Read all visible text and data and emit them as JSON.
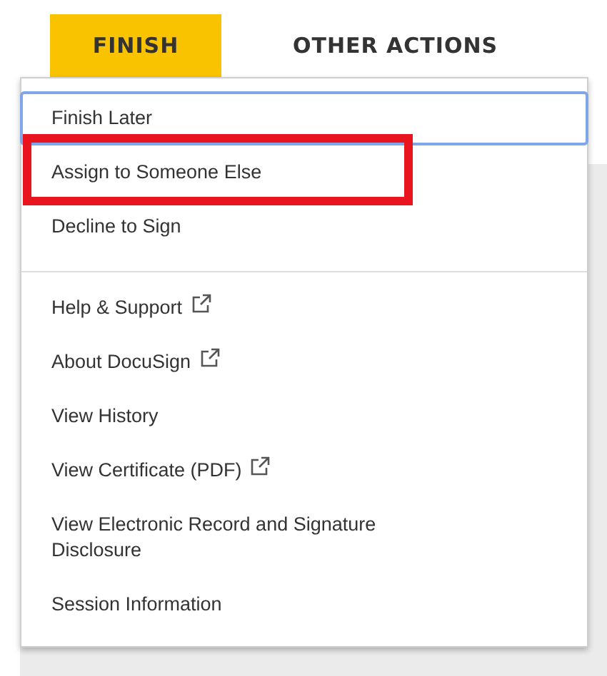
{
  "tabs": [
    {
      "label": "FINISH",
      "selected": true
    },
    {
      "label": "OTHER ACTIONS",
      "selected": false
    }
  ],
  "menu": {
    "groups": [
      {
        "items": [
          {
            "label": "Finish Later",
            "focused": true,
            "highlighted": false,
            "external": false
          },
          {
            "label": "Assign to Someone Else",
            "focused": false,
            "highlighted": true,
            "external": false
          },
          {
            "label": "Decline to Sign",
            "focused": false,
            "highlighted": false,
            "external": false
          }
        ]
      },
      {
        "items": [
          {
            "label": "Help & Support",
            "focused": false,
            "highlighted": false,
            "external": true
          },
          {
            "label": "About DocuSign",
            "focused": false,
            "highlighted": false,
            "external": true
          },
          {
            "label": "View History",
            "focused": false,
            "highlighted": false,
            "external": false
          },
          {
            "label": "View Certificate (PDF)",
            "focused": false,
            "highlighted": false,
            "external": true
          },
          {
            "label": "View Electronic Record and Signature Disclosure",
            "focused": false,
            "highlighted": false,
            "external": false
          },
          {
            "label": "Session Information",
            "focused": false,
            "highlighted": false,
            "external": false
          }
        ]
      }
    ]
  }
}
